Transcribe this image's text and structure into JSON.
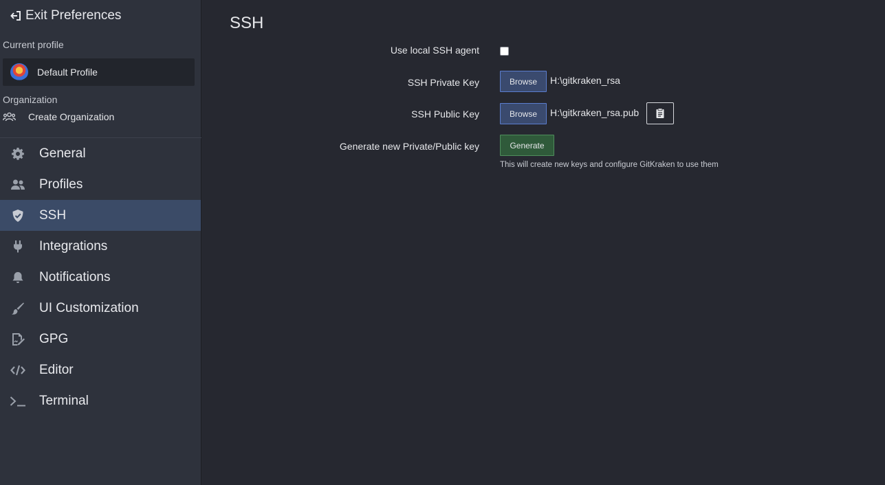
{
  "sidebar": {
    "exit_label": "Exit Preferences",
    "current_profile_label": "Current profile",
    "profile_name": "Default Profile",
    "organization_label": "Organization",
    "create_org_label": "Create Organization",
    "nav": [
      {
        "label": "General",
        "icon": "gear-icon"
      },
      {
        "label": "Profiles",
        "icon": "users-icon"
      },
      {
        "label": "SSH",
        "icon": "shield-icon",
        "active": true
      },
      {
        "label": "Integrations",
        "icon": "plug-icon"
      },
      {
        "label": "Notifications",
        "icon": "bell-icon"
      },
      {
        "label": "UI Customization",
        "icon": "brush-icon"
      },
      {
        "label": "GPG",
        "icon": "signature-icon"
      },
      {
        "label": "Editor",
        "icon": "code-icon"
      },
      {
        "label": "Terminal",
        "icon": "terminal-icon"
      }
    ]
  },
  "main": {
    "title": "SSH",
    "use_agent_label": "Use local SSH agent",
    "use_agent_checked": false,
    "private_key_label": "SSH Private Key",
    "private_key_browse": "Browse",
    "private_key_path": "H:\\gitkraken_rsa",
    "public_key_label": "SSH Public Key",
    "public_key_browse": "Browse",
    "public_key_path": "H:\\gitkraken_rsa.pub",
    "generate_label": "Generate new Private/Public key",
    "generate_button": "Generate",
    "generate_hint": "This will create new keys and configure GitKraken to use them"
  },
  "colors": {
    "sidebar_bg": "#2e323c",
    "main_bg": "#262830",
    "active_nav": "#3b4b67",
    "browse_border": "#5b7ecf",
    "generate_border": "#4f8e5c"
  }
}
